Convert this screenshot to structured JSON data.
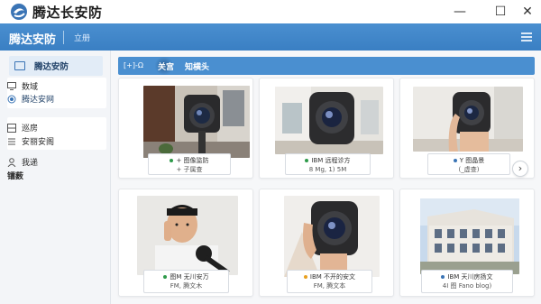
{
  "app": {
    "title": "腾达长安防"
  },
  "window_controls": {
    "minimize": "—",
    "maximize": "☐",
    "close": "✕"
  },
  "navbar": {
    "brand": "腾达安防",
    "link": "立册"
  },
  "sidebar": {
    "header": "腾达安防",
    "items": [
      {
        "label": "数域",
        "icon": "monitor-icon"
      },
      {
        "label": "腾达安网",
        "icon": "radio-dot-icon"
      },
      {
        "label": "巡房",
        "icon": "grid-box-icon"
      },
      {
        "label": "安丽安阁",
        "icon": "list-icon"
      },
      {
        "label": "我递",
        "icon": "user-icon"
      },
      {
        "label": "镭薮",
        "icon": ""
      }
    ]
  },
  "tabs": {
    "icon_text": "[+]-Ω",
    "items": [
      "关宫",
      "知横头"
    ]
  },
  "cards": [
    {
      "line1": "+ 图像监防",
      "line2": "+ 子属查",
      "dot": "#2e9a4a"
    },
    {
      "line1": "IBM 远程诊方",
      "line2": "8 Mg, 1) 5M",
      "dot": "#2e9a4a"
    },
    {
      "line1": "Y 图晶景",
      "line2": "(_虚查)",
      "dot": "#3a74b5"
    },
    {
      "line1": "图M 无川安万",
      "line2": "FM, 腾文木",
      "dot": "#2e9a4a"
    },
    {
      "line1": "IBM 不开的安文",
      "line2": "FM, 腾文本",
      "dot": "#e8a020"
    },
    {
      "line1": "IBM 天川房扬文",
      "line2": "4I 图 Fano blog)",
      "dot": "#3a74b5"
    }
  ],
  "next_button": "›"
}
